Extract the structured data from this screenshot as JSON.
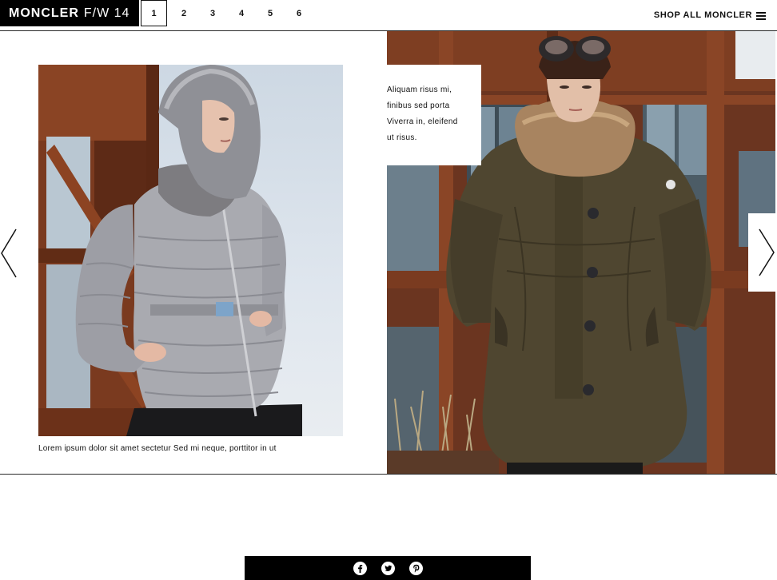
{
  "header": {
    "brand_bold": "MONCLER",
    "brand_light": "F/W 14",
    "pages": [
      "1",
      "2",
      "3",
      "4",
      "5",
      "6"
    ],
    "active_page": "1",
    "shop_all_label": "SHOP ALL MONCLER"
  },
  "left_panel": {
    "caption": "Lorem ipsum dolor sit amet sectetur Sed mi neque, porttitor in ut"
  },
  "right_panel": {
    "note_lines": [
      "Aliquam risus mi,",
      "finibus sed porta",
      "Viverra in, eleifend",
      "ut risus."
    ]
  },
  "icons": {
    "menu": "hamburger-icon",
    "prev": "chevron-left-icon",
    "next": "chevron-right-icon",
    "social": [
      "facebook-icon",
      "twitter-icon",
      "pinterest-icon"
    ]
  },
  "colors": {
    "brand_bg": "#000000",
    "social_bar_bg": "#000000",
    "rust": "#7a3a1f",
    "parka": "#4f4630",
    "silver_jacket": "#a9aab0"
  }
}
